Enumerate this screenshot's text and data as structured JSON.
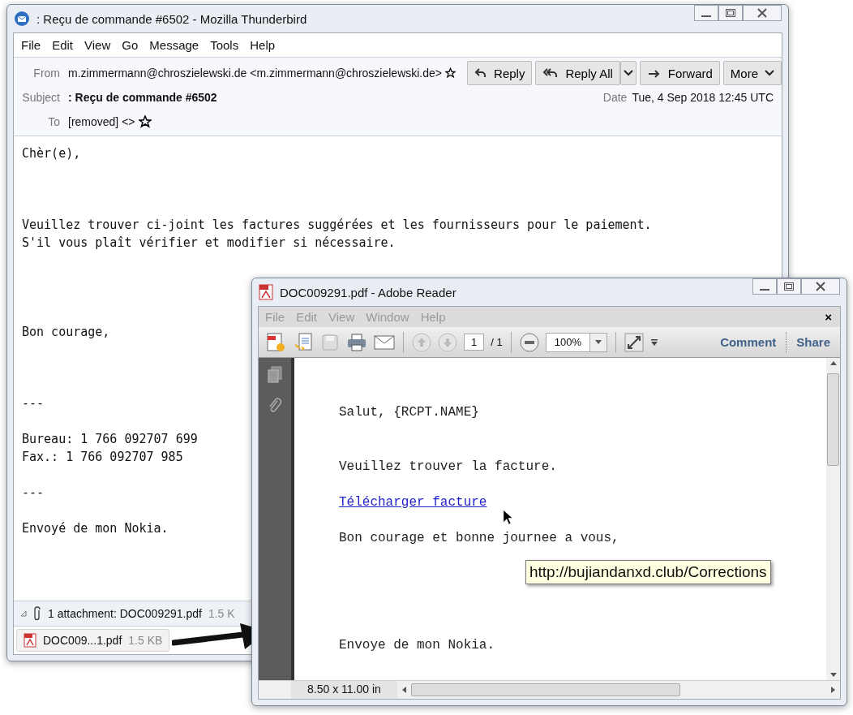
{
  "mail_window": {
    "title": ": Reçu de commande #6502 - Mozilla Thunderbird",
    "menu": [
      "File",
      "Edit",
      "View",
      "Go",
      "Message",
      "Tools",
      "Help"
    ],
    "header": {
      "from_label": "From",
      "from": "m.zimmermann@chroszielewski.de <m.zimmermann@chroszielewski.de>",
      "subject_label": "Subject",
      "subject": ": Reçu de commande #6502",
      "to_label": "To",
      "to": "[removed] <>",
      "date_label": "Date",
      "date": "Tue, 4 Sep 2018 12:45 UTC"
    },
    "buttons": [
      {
        "label": "Reply",
        "kind": "reply"
      },
      {
        "label": "Reply All",
        "kind": "replyall"
      },
      {
        "label": "Forward",
        "kind": "forward"
      },
      {
        "label": "More",
        "kind": "more"
      }
    ],
    "body": [
      {
        "lines": [
          "Chèr(e),"
        ]
      },
      {
        "lines": [
          "Veuillez trouver ci-joint les factures suggérées et les fournisseurs pour le paiement.",
          "S'il vous plaît vérifier et modifier si nécessaire."
        ]
      },
      {
        "lines": [
          "Bon courage,"
        ]
      },
      {
        "lines": [
          "---"
        ]
      },
      {
        "lines": [
          "Bureau: 1 766 092707 699",
          "Fax.: 1 766 092707 985"
        ]
      },
      {
        "lines": [
          "---"
        ]
      },
      {
        "lines": [
          "Envoyé de mon Nokia."
        ]
      }
    ],
    "attachment_summary": "1 attachment: DOC009291.pdf",
    "attachment_summary_size": "1.5 K",
    "attachment": {
      "name": "DOC009...1.pdf",
      "size": "1.5 KB"
    }
  },
  "reader_window": {
    "title": "DOC009291.pdf - Adobe Reader",
    "menu": [
      {
        "label": "File",
        "disabled": true
      },
      {
        "label": "Edit",
        "disabled": true
      },
      {
        "label": "View",
        "disabled": true
      },
      {
        "label": "Window",
        "disabled": true
      },
      {
        "label": "Help",
        "disabled": true
      }
    ],
    "menu_close": "×",
    "page": "1",
    "page_total": "/ 1",
    "zoom": "100%",
    "comment": "Comment",
    "share": "Share",
    "document": {
      "greeting": "Salut, {RCPT.NAME}",
      "line": "Veuillez trouver la facture.",
      "link": "Télécharger facture",
      "closing": "Bon courage et bonne journee a vous,",
      "footer": "Envoye de mon Nokia."
    },
    "page_size": "8.50 x 11.00 in",
    "tooltip": "http://bujiandanxd.club/Corrections"
  }
}
